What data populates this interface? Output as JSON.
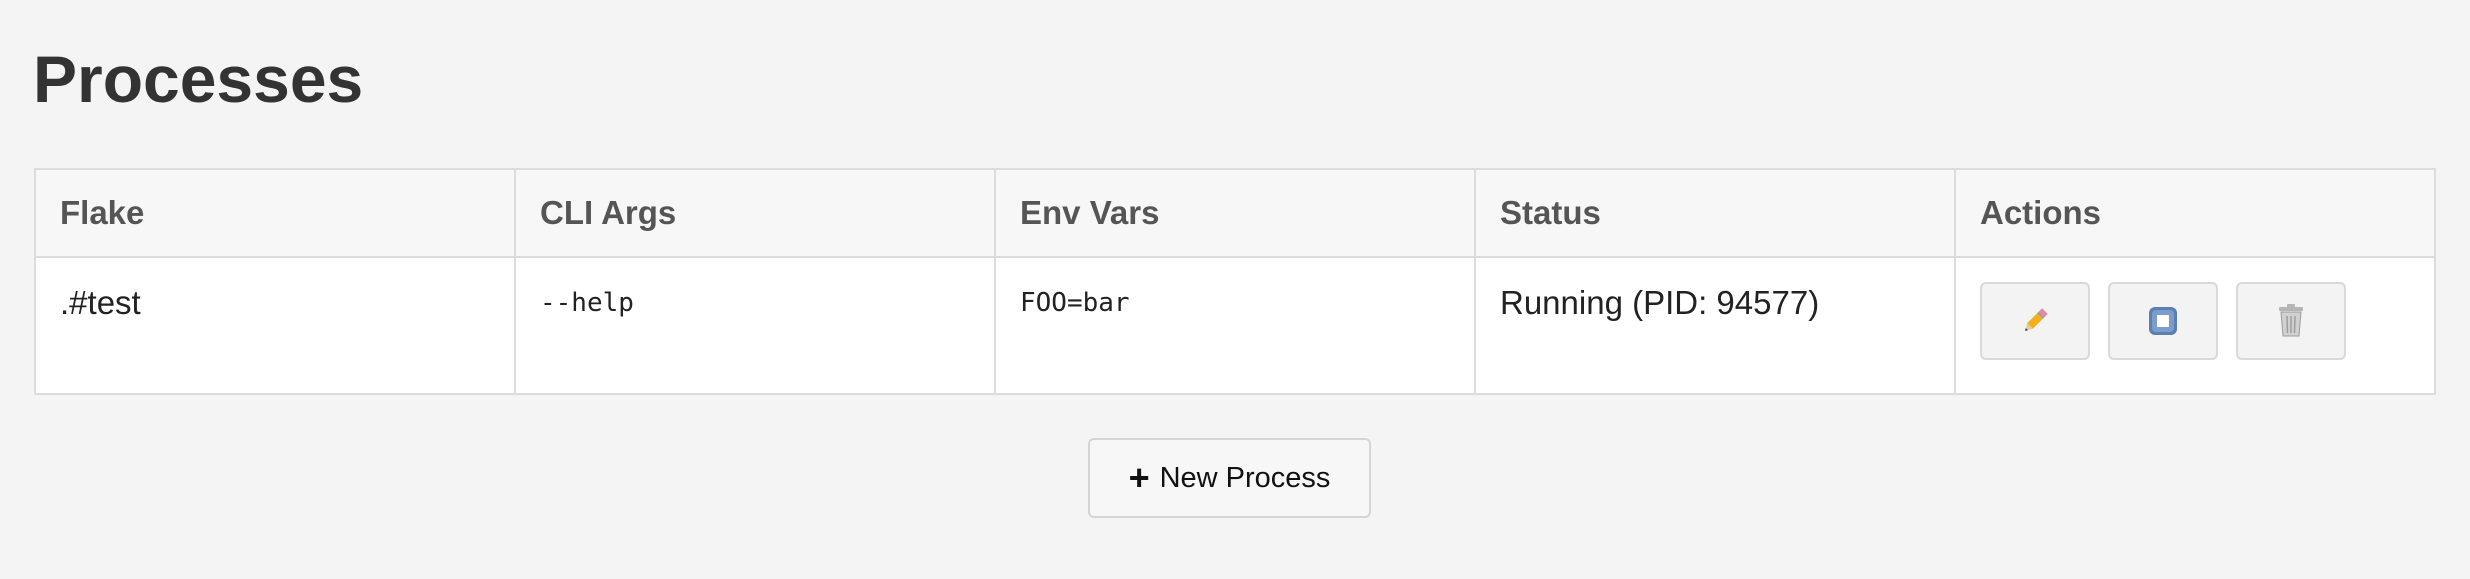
{
  "page": {
    "title": "Processes"
  },
  "table": {
    "headers": [
      "Flake",
      "CLI Args",
      "Env Vars",
      "Status",
      "Actions"
    ],
    "rows": [
      {
        "flake": ".#test",
        "cli_args": "--help",
        "env_vars": "FOO=bar",
        "status": "Running (PID: 94577)",
        "actions": [
          {
            "name": "edit",
            "icon": "pencil-icon"
          },
          {
            "name": "stop",
            "icon": "stop-icon"
          },
          {
            "name": "delete",
            "icon": "trash-icon"
          }
        ]
      }
    ]
  },
  "new_process": {
    "icon": "+",
    "label": "New Process"
  },
  "colors": {
    "background": "#f4f4f4",
    "table_header_bg": "#f7f7f7",
    "border": "#dcdcdc",
    "stop_icon": "#5b7fb0"
  }
}
